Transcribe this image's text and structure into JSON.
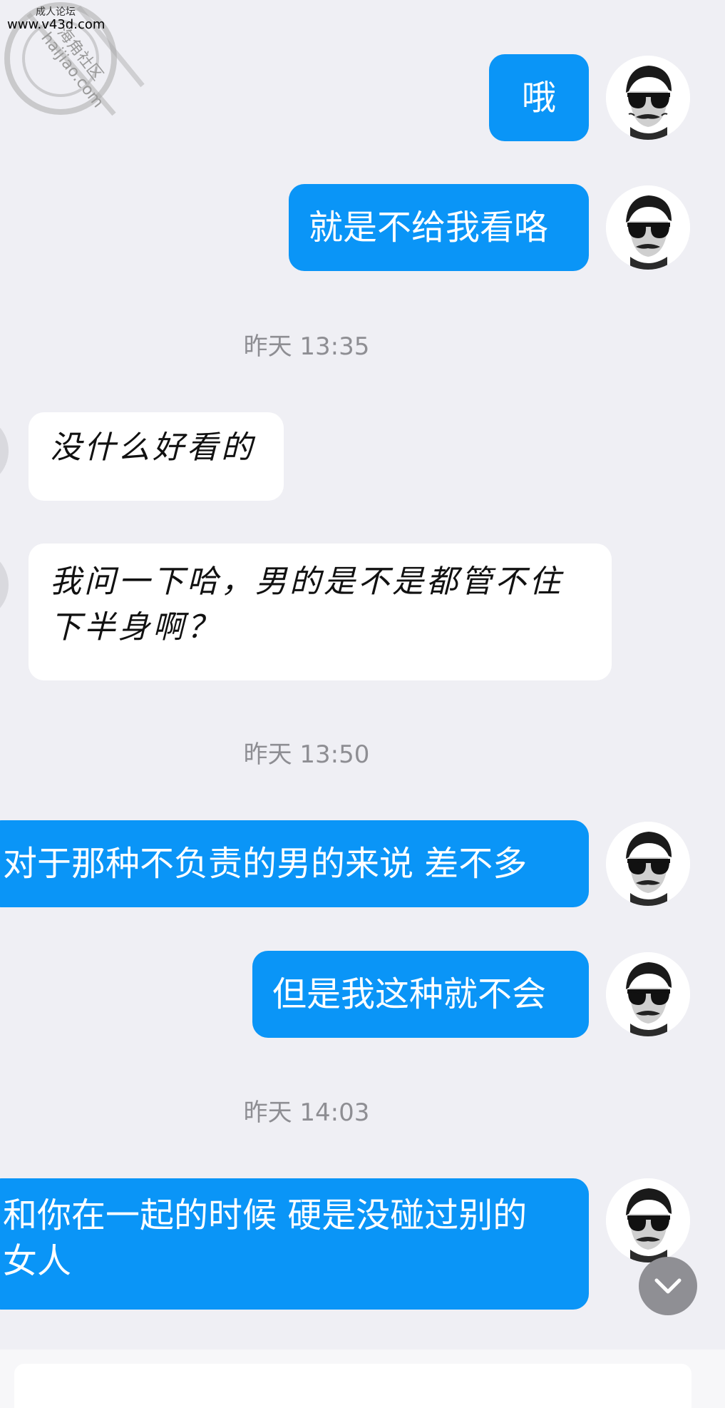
{
  "watermark": {
    "top_text": "成人论坛",
    "site_text": "www.v43d.com",
    "seal_text": "海角社区",
    "seal_domain": "haijiao.com"
  },
  "messages": [
    {
      "direction": "out",
      "text": "哦"
    },
    {
      "direction": "out",
      "text": "就是不给我看咯"
    },
    {
      "direction": "in",
      "text": "没什么好看的"
    },
    {
      "direction": "in",
      "text": "我问一下哈，男的是不是都管不住下半身啊？"
    },
    {
      "direction": "out",
      "text": "对于那种不负责的男的来说 差不多"
    },
    {
      "direction": "out",
      "text": "但是我这种就不会"
    },
    {
      "direction": "out",
      "text": "和你在一起的时候 硬是没碰过别的女人"
    }
  ],
  "timestamps": [
    "昨天 13:35",
    "昨天 13:50",
    "昨天 14:03"
  ],
  "icons": {
    "scroll_down": "chevron-down-icon",
    "avatar": "avatar-sunglasses-mustache"
  },
  "colors": {
    "outgoing_bubble": "#0a95f7",
    "incoming_bubble": "#ffffff",
    "background": "#efeff4",
    "timestamp": "#8e8e93"
  }
}
